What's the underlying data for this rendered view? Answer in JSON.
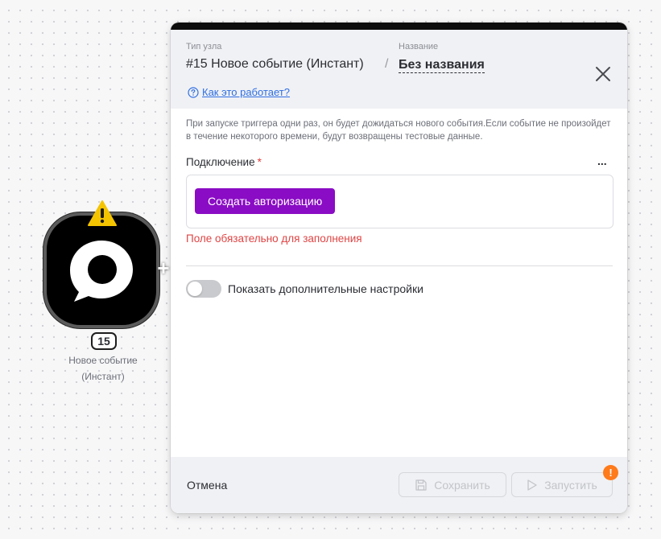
{
  "node": {
    "number": "15",
    "label_line1": "Новое событие",
    "label_line2": "(Инстант)",
    "warning_icon": "warning-triangle-icon",
    "logo_icon": "speech-bubble-logo-icon"
  },
  "panel": {
    "type_caption": "Тип узла",
    "name_caption": "Название",
    "title": "#15 Новое событие (Инстант)",
    "separator": "/",
    "name": "Без названия",
    "help_link": "Как это работает?",
    "description": "При запуске триггера одни раз, он будет дожидаться нового события.Если событие не произойдет в течение некоторого времени, будут возвращены тестовые данные.",
    "connection": {
      "label": "Подключение",
      "required_mark": "*",
      "more": "...",
      "auth_button": "Создать авторизацию",
      "error": "Поле обязательно для заполнения"
    },
    "advanced_toggle": {
      "label": "Показать дополнительные настройки",
      "enabled": false
    },
    "footer": {
      "cancel": "Отмена",
      "save": "Сохранить",
      "run": "Запустить",
      "run_badge": "!"
    }
  },
  "colors": {
    "accent_purple": "#8a0cc4",
    "error_red": "#e04444",
    "link_blue": "#2f6fe4",
    "badge_orange": "#ff7a1a",
    "warning_yellow": "#f5c400"
  }
}
